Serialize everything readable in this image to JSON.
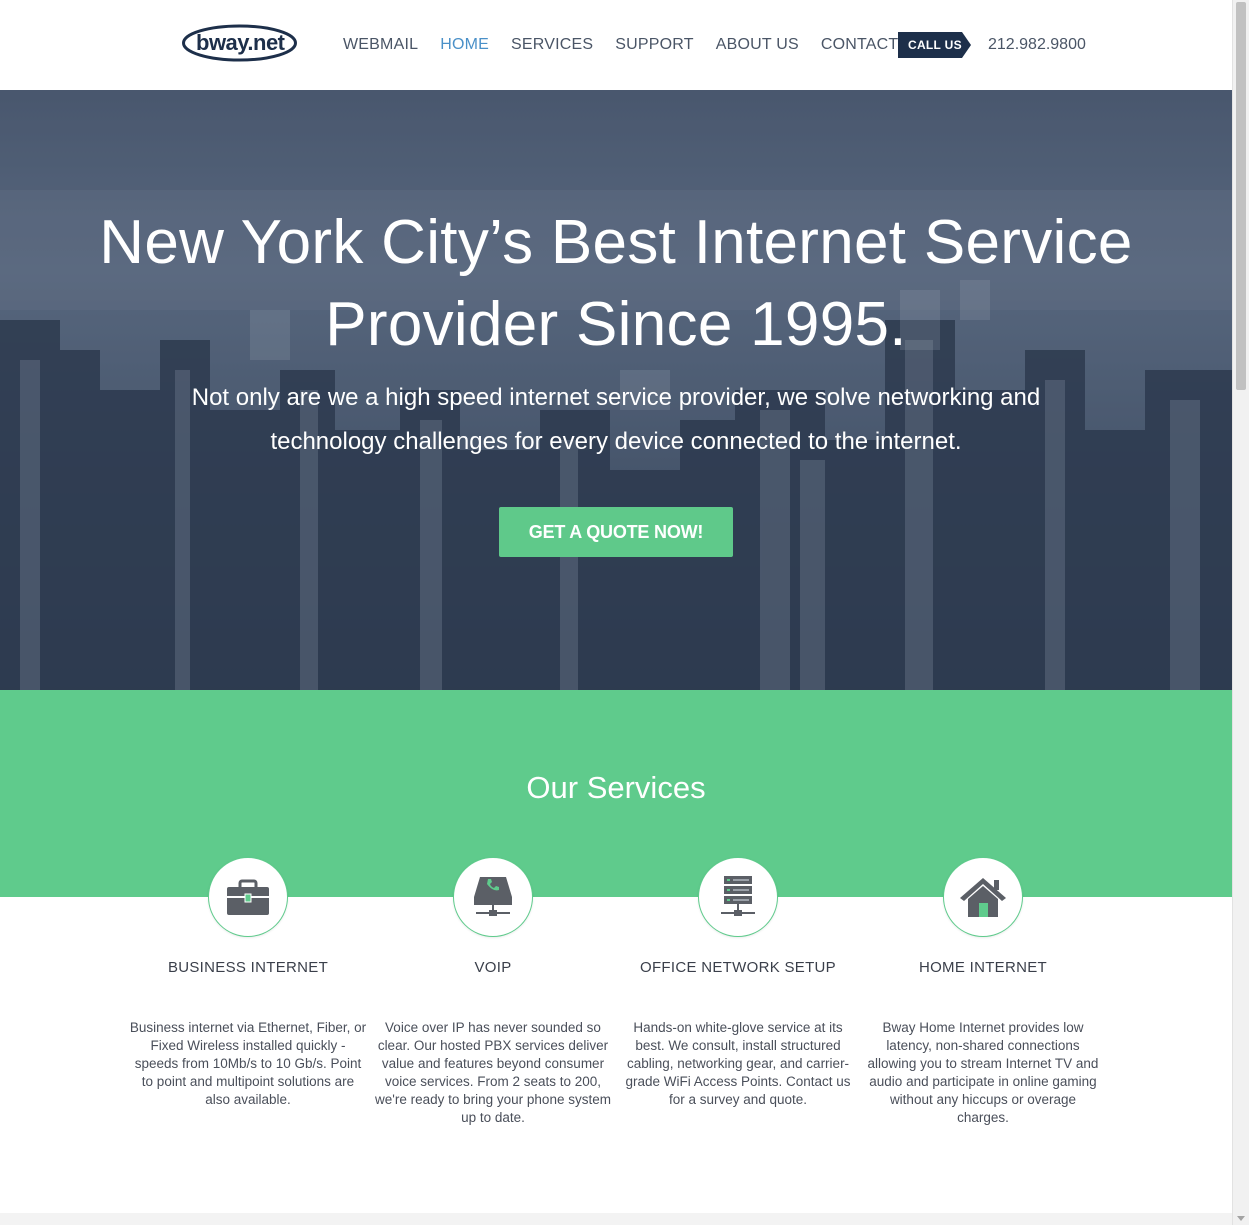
{
  "header": {
    "logo_text": "bway.net",
    "nav": [
      "WEBMAIL",
      "HOME",
      "SERVICES",
      "SUPPORT",
      "ABOUT US",
      "CONTACT US"
    ],
    "active_nav": "HOME",
    "call_label": "CALL US",
    "phone": "212.982.9800"
  },
  "hero": {
    "title": "New York City’s Best Internet Service Provider Since 1995.",
    "subtitle": "Not only are we a high speed internet service provider, we solve networking and technology challenges for every device connected to the internet.",
    "cta": "GET A QUOTE NOW!"
  },
  "services": {
    "title": "Our Services",
    "items": [
      {
        "icon": "briefcase-icon",
        "title": "BUSINESS INTERNET",
        "description": "Business internet via Ethernet, Fiber, or Fixed Wireless installed quickly - speeds from 10Mb/s to 10 Gb/s. Point to point and multipoint solutions are also available."
      },
      {
        "icon": "voip-phone-icon",
        "title": "VOIP",
        "description": "Voice over IP has never sounded so clear. Our hosted PBX services deliver value and features beyond consumer voice services. From 2 seats to 200, we're ready to bring your phone system up to date."
      },
      {
        "icon": "server-rack-icon",
        "title": "OFFICE NETWORK SETUP",
        "description": "Hands-on white-glove service at its best. We consult, install structured cabling, networking gear, and carrier-grade WiFi Access Points. Contact us for a survey and quote."
      },
      {
        "icon": "home-icon",
        "title": "HOME INTERNET",
        "description": "Bway Home Internet provides low latency, non-shared connections allowing you to stream Internet TV and audio and participate in online gaming without any hiccups or overage charges."
      }
    ]
  },
  "colors": {
    "accent_green": "#5fcb8c",
    "nav_active": "#4a90c8",
    "navy": "#1d2f4a"
  }
}
